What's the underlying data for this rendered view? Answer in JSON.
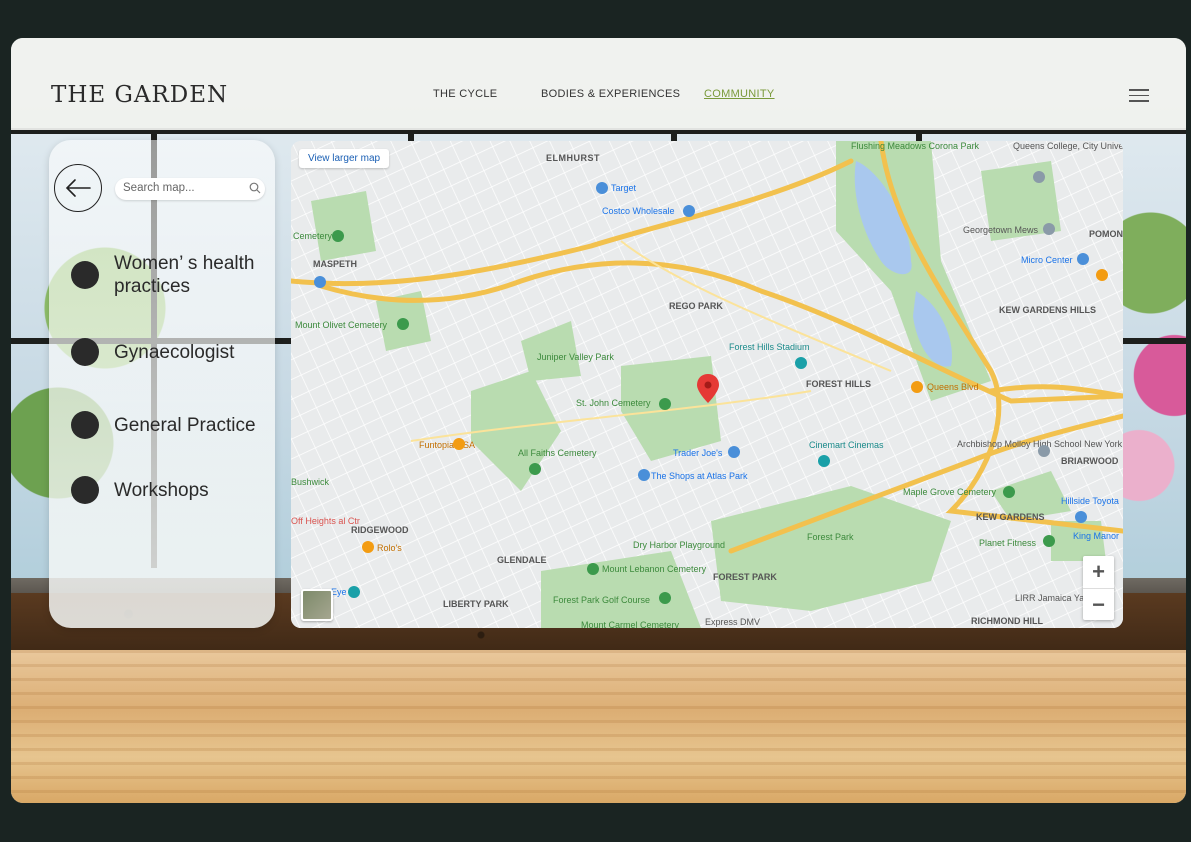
{
  "app": {
    "logo": "THE GARDEN"
  },
  "nav": [
    {
      "label": "THE CYCLE",
      "active": false
    },
    {
      "label": "BODIES & EXPERIENCES",
      "active": false
    },
    {
      "label": "COMMUNITY",
      "active": true
    }
  ],
  "panel": {
    "search_placeholder": "Search map...",
    "categories": [
      {
        "label": "Women’ s health practices"
      },
      {
        "label": "Gynaecologist"
      },
      {
        "label": "General Practice"
      },
      {
        "label": "Workshops"
      }
    ]
  },
  "map": {
    "view_larger": "View larger map",
    "zoom_in": "+",
    "zoom_out": "−",
    "areas": [
      "ELMHURST",
      "MASPETH",
      "REGO PARK",
      "FOREST HILLS",
      "KEW GARDENS HILLS",
      "BRIARWOOD",
      "KEW GARDENS",
      "RIDGEWOOD",
      "GLENDALE",
      "FOREST PARK",
      "LIBERTY PARK",
      "RICHMOND HILL",
      "POMON"
    ],
    "places": [
      "Target",
      "Costco Wholesale",
      "Cemetery",
      "Mount Olivet Cemetery",
      "Juniper Valley Park",
      "St. John Cemetery",
      "Forest Hills Stadium",
      "Queens Blvd",
      "Trader Joe's",
      "The Shops at Atlas Park",
      "Cinemart Cinemas",
      "Funtopia USA",
      "All Faiths Cemetery",
      "Bushwick",
      "Rolo's",
      "Dry Harbor Playground",
      "Mount Lebanon Cemetery",
      "Forest Park",
      "Forest Park Golf Course",
      "Maple Grove Cemetery",
      "Planet Fitness",
      "Hillside Toyota",
      "King Manor",
      "Archbishop Molloy High School New York",
      "Georgetown Mews",
      "Micro Center",
      "Flushing Meadows Corona Park",
      "Queens College, City University of New York",
      "LIRR Jamaica Yard",
      "Express DMV",
      "Mount Carmel Cemetery",
      "Eye",
      "Off Heights al Ctr"
    ],
    "colors": {
      "park": "#b9dcb0",
      "highway": "#f2c14e",
      "road": "#ffffff",
      "water": "#a9c8ee",
      "marker": "#e53935"
    }
  }
}
